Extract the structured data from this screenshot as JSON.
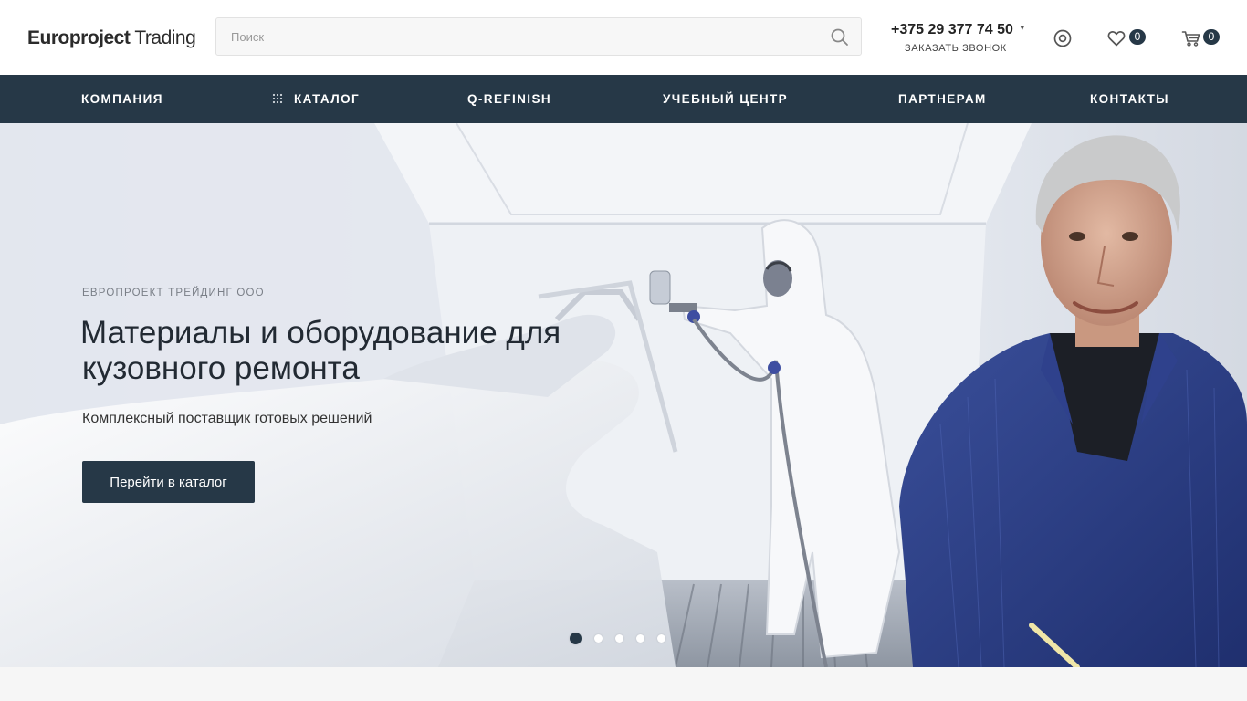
{
  "header": {
    "logo": {
      "bold": "Europroject",
      "light": "Trading"
    },
    "search": {
      "placeholder": "Поиск",
      "value": ""
    },
    "phone": "+375 29 377 74 50",
    "callback_label": "Заказать звонок",
    "favorites_count": "0",
    "cart_count": "0"
  },
  "nav": {
    "items": [
      {
        "label": "Компания"
      },
      {
        "label": "Каталог"
      },
      {
        "label": "Q-Refinish"
      },
      {
        "label": "Учебный центр"
      },
      {
        "label": "Партнерам"
      },
      {
        "label": "Контакты"
      }
    ]
  },
  "hero": {
    "eyebrow": "Европроект Трейдинг ООО",
    "title_line1": "Материалы и оборудование для",
    "title_line2": "кузовного ремонта",
    "subtitle": "Комплексный поставщик готовых решений",
    "button_label": "Перейти в каталог",
    "slides_total": 5,
    "active_slide": 1
  },
  "colors": {
    "accent": "#263847",
    "badge": "#263847",
    "page_bg": "#f6f6f6"
  },
  "icons": {
    "search": "search-icon",
    "profile": "user-circle-icon",
    "favorites": "heart-icon",
    "cart": "cart-icon",
    "catalog": "grid-dots-icon"
  }
}
